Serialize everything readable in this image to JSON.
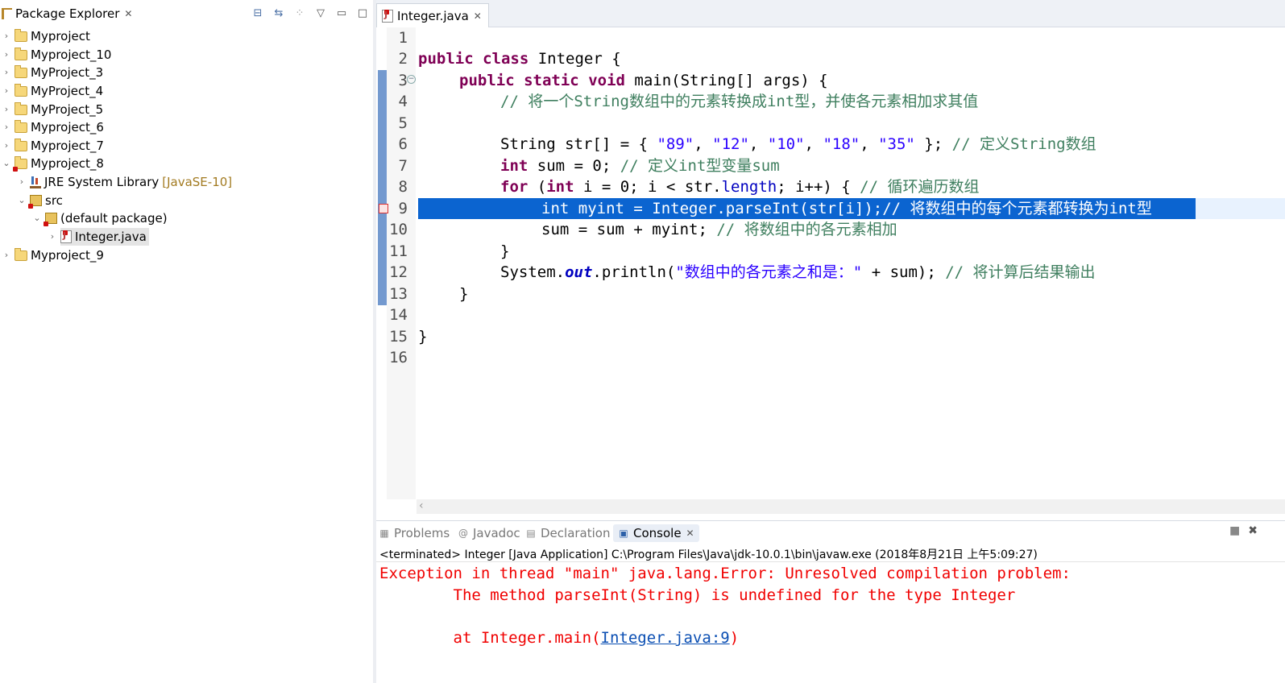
{
  "package_explorer": {
    "title": "Package Explorer",
    "tree": [
      {
        "label": "Myproject"
      },
      {
        "label": "Myproject_10"
      },
      {
        "label": "MyProject_3"
      },
      {
        "label": "MyProject_4"
      },
      {
        "label": "MyProject_5"
      },
      {
        "label": "Myproject_6"
      },
      {
        "label": "Myproject_7"
      },
      {
        "label": "Myproject_8"
      },
      {
        "label": "JRE System Library",
        "decoration": "[JavaSE-10]"
      },
      {
        "label": "src"
      },
      {
        "label": "(default package)"
      },
      {
        "label": "Integer.java"
      },
      {
        "label": "Myproject_9"
      }
    ]
  },
  "editor": {
    "tab_label": "Integer.java",
    "line_numbers": [
      "1",
      "2",
      "3",
      "4",
      "5",
      "6",
      "7",
      "8",
      "9",
      "10",
      "11",
      "12",
      "13",
      "14",
      "15",
      "16"
    ],
    "tokens": {
      "public": "public",
      "class": "class",
      "static": "static",
      "void": "void",
      "int": "int",
      "for": "for",
      "l2_rest": " Integer {",
      "l3_rest": " main(String[] args) {",
      "l4_comment": "// 将一个String数组中的元素转换成int型，并使各元素相加求其值",
      "l6_a": "String str[] = { ",
      "s89": "\"89\"",
      "s12": "\"12\"",
      "s10": "\"10\"",
      "s18": "\"18\"",
      "s35": "\"35\"",
      "comma": ", ",
      "l6_b": " }; ",
      "l6_comment": "// 定义String数组",
      "l7_a": " sum = 0; ",
      "l7_comment": "// 定义int型变量sum",
      "l8_a": " (",
      "l8_b": " i = 0; i < str.",
      "l8_field": "length",
      "l8_c": "; i++) { ",
      "l8_comment": "// 循环遍历数组",
      "l9_code": "int myint = Integer.parseInt(str[i]);// 将数组中的每个元素都转换为int型",
      "l10_a": "sum = sum + myint; ",
      "l10_comment": "// 将数组中的各元素相加",
      "l11": "}",
      "l12_a": "System.",
      "l12_out": "out",
      "l12_b": ".println(",
      "l12_str": "\"数组中的各元素之和是：\"",
      "l12_c": " + sum); ",
      "l12_comment": "// 将计算后结果输出",
      "l13": "}",
      "l15": "}"
    }
  },
  "console": {
    "tabs": {
      "problems": "Problems",
      "javadoc": "Javadoc",
      "declaration": "Declaration",
      "console": "Console"
    },
    "status": "<terminated> Integer [Java Application] C:\\Program Files\\Java\\jdk-10.0.1\\bin\\javaw.exe (2018年8月21日 上午5:09:27)",
    "line1": "Exception in thread \"main\" java.lang.Error: Unresolved compilation problem: ",
    "line2": "\tThe method parseInt(String) is undefined for the type Integer",
    "line3_prefix": "\tat Integer.main(",
    "line3_link": "Integer.java:9",
    "line3_suffix": ")"
  }
}
